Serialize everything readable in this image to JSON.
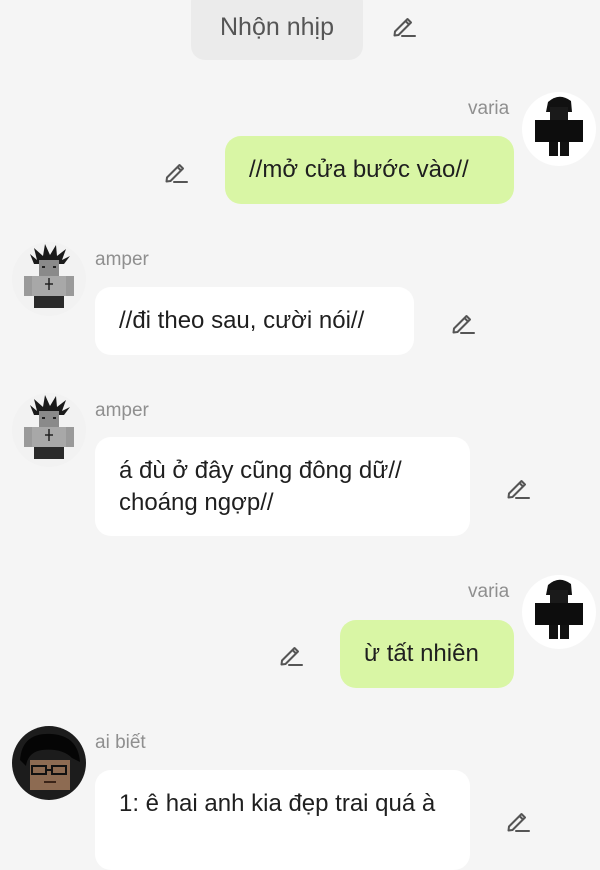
{
  "header": {
    "title": "Nhộn nhịp"
  },
  "messages": [
    {
      "sender": "varia",
      "text": "//mở cửa bước vào//",
      "side": "right",
      "avatar_icon": "varia-avatar"
    },
    {
      "sender": "amper",
      "text": "//đi theo sau, cười nói//",
      "side": "left",
      "avatar_icon": "amper-avatar"
    },
    {
      "sender": "amper",
      "text": "á đù ở đây cũng đông dữ// choáng ngợp//",
      "side": "left",
      "avatar_icon": "amper-avatar"
    },
    {
      "sender": "varia",
      "text": "ừ tất nhiên",
      "side": "right",
      "avatar_icon": "varia-avatar"
    },
    {
      "sender": "ai biết",
      "text": "1: ê hai anh kia đẹp trai quá à",
      "side": "left",
      "avatar_icon": "ai-biet-avatar"
    }
  ],
  "icons": {
    "edit": "pencil-icon"
  },
  "colors": {
    "background": "#f5f5f5",
    "my_bubble": "#d9f6a5",
    "their_bubble": "#ffffff",
    "name_text": "#8f8f8f"
  }
}
